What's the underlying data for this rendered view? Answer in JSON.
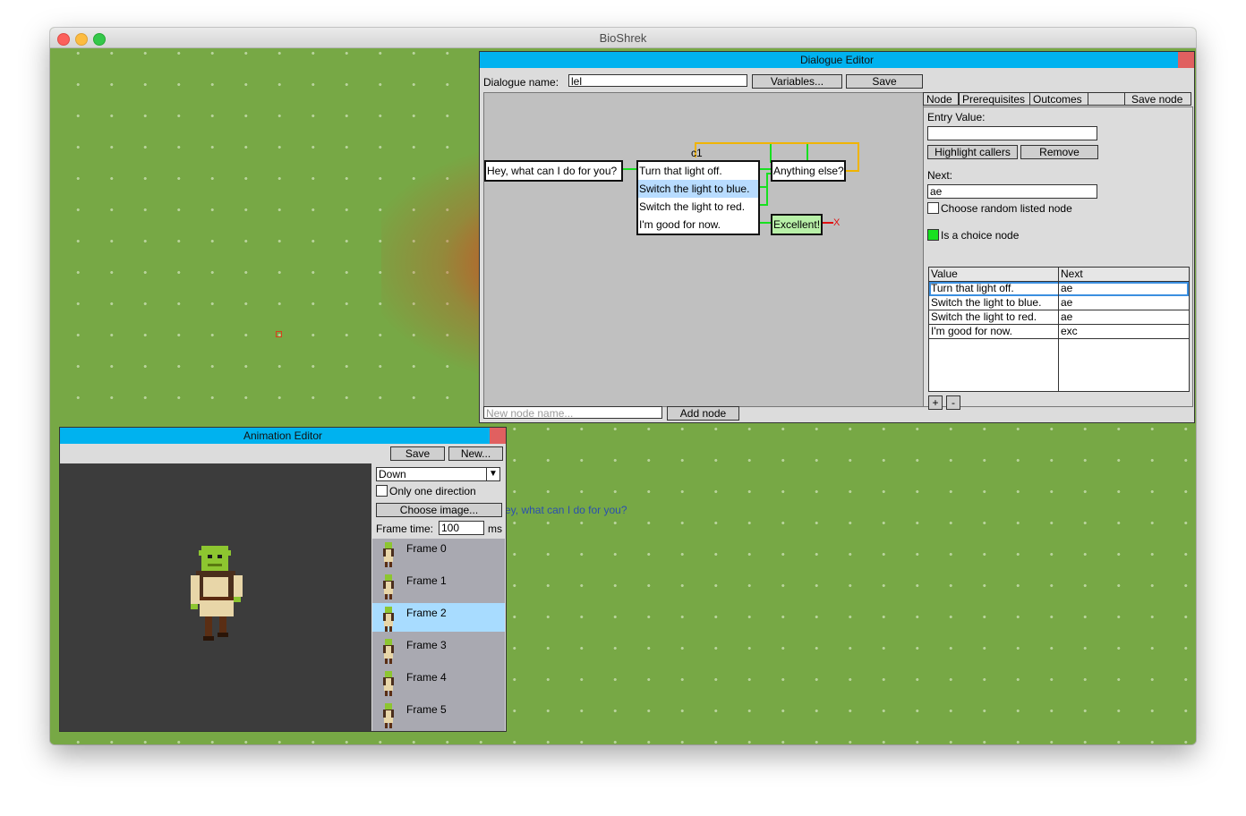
{
  "window": {
    "title": "BioShrek"
  },
  "game": {
    "speech_text": "ey, what can I do for you?"
  },
  "dialogue_editor": {
    "title": "Dialogue Editor",
    "name_label": "Dialogue name:",
    "name_value": "lel",
    "variables_button": "Variables...",
    "save_button": "Save",
    "tabs": [
      "Node",
      "Prerequisites",
      "Outcomes",
      "",
      "Save node"
    ],
    "graph": {
      "root_node": "Hey, what can I do for you?",
      "choice_node_label": "c1",
      "choices": [
        "Turn that light off.",
        "Switch the light to blue.",
        "Switch the light to red.",
        "I'm good for now."
      ],
      "anything_node": "Anything else?",
      "excellent_node": "Excellent!",
      "end_mark": "X"
    },
    "node_panel": {
      "entry_value_label": "Entry Value:",
      "entry_value": "",
      "highlight_callers_button": "Highlight callers",
      "remove_button": "Remove",
      "next_label": "Next:",
      "next_value": "ae",
      "random_label": "Choose random listed node",
      "choice_label": "Is a choice node",
      "table": {
        "headers": [
          "Value",
          "Next"
        ],
        "rows": [
          [
            "Turn that light off.",
            "ae"
          ],
          [
            "Switch the light to blue.",
            "ae"
          ],
          [
            "Switch the light to red.",
            "ae"
          ],
          [
            "I'm good for now.",
            "exc"
          ]
        ]
      },
      "add_button": "+",
      "remove_row_button": "-"
    },
    "new_node_placeholder": "New node name...",
    "add_node_button": "Add node"
  },
  "animation_editor": {
    "title": "Animation Editor",
    "save_button": "Save",
    "new_button": "New...",
    "direction": "Down",
    "one_direction_label": "Only one direction",
    "choose_image_button": "Choose image...",
    "frame_time_label": "Frame time:",
    "frame_time_value": "100",
    "frame_time_unit": "ms",
    "frames": [
      "Frame 0",
      "Frame 1",
      "Frame 2",
      "Frame 3",
      "Frame 4",
      "Frame 5"
    ],
    "selected_frame": "Frame 2"
  },
  "colors": {
    "titlebar_blue": "#00b2ef",
    "grass": "#77a845",
    "choice_green": "#18e020",
    "selection_blue": "#a8dcff"
  }
}
